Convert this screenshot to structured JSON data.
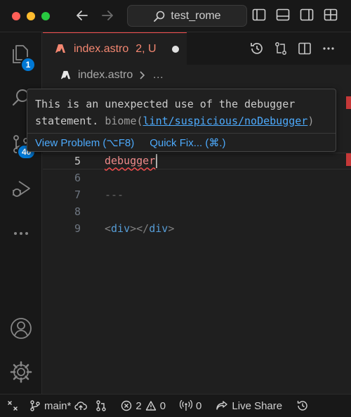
{
  "titlebar": {
    "search_label": "test_rome"
  },
  "activity_bar": {
    "explorer_badge": "1",
    "scm_badge": "40"
  },
  "tab": {
    "filename": "index.astro",
    "status": "2, U"
  },
  "breadcrumb": {
    "file": "index.astro",
    "ellipsis": "…"
  },
  "editor": {
    "lines": [
      {
        "number": "5",
        "text": "debugger"
      },
      {
        "number": "6",
        "text": ""
      },
      {
        "number": "7",
        "text": "---"
      },
      {
        "number": "8",
        "text": ""
      },
      {
        "number": "9",
        "open_tag": "div",
        "close_tag": "div"
      }
    ]
  },
  "hover": {
    "message_line1": "This is an unexpected use of the debugger",
    "message_line2": "statement.",
    "source": "biome(",
    "rule_link": "lint/suspicious/noDebugger",
    "source_close": ")",
    "view_problem": "View Problem (⌥F8)",
    "quick_fix": "Quick Fix... (⌘.)"
  },
  "statusbar": {
    "branch": "main*",
    "errors": "2",
    "warnings": "0",
    "ports": "0",
    "live_share": "Live Share"
  },
  "colors": {
    "error": "#f14c4c",
    "link": "#4daafc",
    "badge": "#0078d4"
  }
}
